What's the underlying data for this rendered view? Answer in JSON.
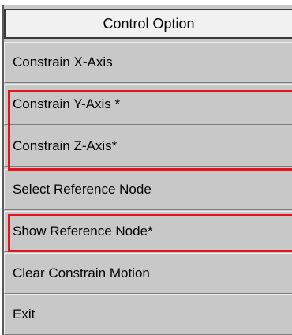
{
  "menu": {
    "title": "Control Option",
    "items": [
      {
        "label": "Constrain X-Axis"
      },
      {
        "label": "Constrain Y-Axis *"
      },
      {
        "label": "Constrain Z-Axis*"
      },
      {
        "label": "Select Reference Node"
      },
      {
        "label": "Show Reference Node*"
      },
      {
        "label": "Clear Constrain Motion"
      },
      {
        "label": "Exit"
      }
    ]
  },
  "colors": {
    "menu_background": "#c8c8c8",
    "title_background": "#f1f1f1",
    "highlight": "#e6141e"
  }
}
